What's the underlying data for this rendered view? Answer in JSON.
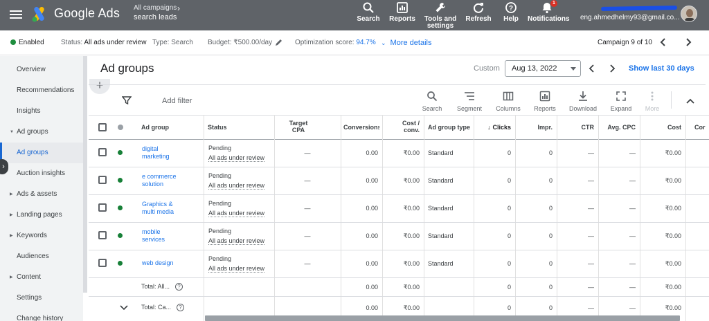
{
  "header": {
    "brand": "Google Ads",
    "campaign_selector": {
      "line1": "All campaigns",
      "line2": "search leads"
    },
    "tools": [
      {
        "label": "Search",
        "icon": "search-icon"
      },
      {
        "label": "Reports",
        "icon": "reports-icon"
      },
      {
        "label": "Tools and settings",
        "icon": "wrench-icon"
      },
      {
        "label": "Refresh",
        "icon": "refresh-icon"
      },
      {
        "label": "Help",
        "icon": "help-icon"
      },
      {
        "label": "Notifications",
        "icon": "bell-icon",
        "badge": "1"
      }
    ],
    "account_email": "eng.ahmedhelmy93@gmail.co..."
  },
  "status_bar": {
    "enabled": "Enabled",
    "status_label": "Status:",
    "status_value": "All ads under review",
    "type_label": "Type:",
    "type_value": "Search",
    "budget_label": "Budget:",
    "budget_value": "₹500.00/day",
    "opt_label": "Optimization score:",
    "opt_value": "94.7%",
    "more_details": "More details",
    "campaign_count": "Campaign 9 of 10"
  },
  "sidebar": {
    "items": [
      {
        "label": "Overview"
      },
      {
        "label": "Recommendations"
      },
      {
        "label": "Insights"
      },
      {
        "label": "Ad groups",
        "expandable": true,
        "expanded": true
      },
      {
        "label": "Ad groups",
        "active": true
      },
      {
        "label": "Auction insights"
      },
      {
        "label": "Ads & assets",
        "expandable": true
      },
      {
        "label": "Landing pages",
        "expandable": true
      },
      {
        "label": "Keywords",
        "expandable": true
      },
      {
        "label": "Audiences"
      },
      {
        "label": "Content",
        "expandable": true
      },
      {
        "label": "Settings"
      },
      {
        "label": "Change history"
      }
    ]
  },
  "main": {
    "title": "Ad groups",
    "date_mode": "Custom",
    "date_value": "Aug 13, 2022",
    "show_last": "Show last 30 days",
    "plus": "+",
    "add_filter": "Add filter",
    "toolbar": [
      {
        "label": "Search",
        "icon": "search-icon"
      },
      {
        "label": "Segment",
        "icon": "segment-icon"
      },
      {
        "label": "Columns",
        "icon": "columns-icon"
      },
      {
        "label": "Reports",
        "icon": "reports-icon"
      },
      {
        "label": "Download",
        "icon": "download-icon"
      },
      {
        "label": "Expand",
        "icon": "expand-icon"
      },
      {
        "label": "More",
        "icon": "more-vert-icon",
        "disabled": true
      }
    ]
  },
  "table": {
    "columns": {
      "ad_group": "Ad group",
      "status": "Status",
      "target_cpa_1": "Target",
      "target_cpa_2": "CPA",
      "conversions": "Conversions",
      "cost_conv_1": "Cost /",
      "cost_conv_2": "conv.",
      "ad_group_type": "Ad group type",
      "clicks": "Clicks",
      "impr": "Impr.",
      "ctr": "CTR",
      "avg_cpc": "Avg. CPC",
      "cost": "Cost",
      "cut": "Cor"
    },
    "rows": [
      {
        "name1": "digital",
        "name2": "marketing",
        "status1": "Pending",
        "status2": "All ads under review",
        "target_cpa": "—",
        "conversions": "0.00",
        "cost_conv": "₹0.00",
        "type": "Standard",
        "clicks": "0",
        "impr": "0",
        "ctr": "—",
        "avg_cpc": "—",
        "cost": "₹0.00"
      },
      {
        "name1": "e commerce",
        "name2": "solution",
        "status1": "Pending",
        "status2": "All ads under review",
        "target_cpa": "—",
        "conversions": "0.00",
        "cost_conv": "₹0.00",
        "type": "Standard",
        "clicks": "0",
        "impr": "0",
        "ctr": "—",
        "avg_cpc": "—",
        "cost": "₹0.00"
      },
      {
        "name1": "Graphics &",
        "name2": "multi media",
        "status1": "Pending",
        "status2": "All ads under review",
        "target_cpa": "—",
        "conversions": "0.00",
        "cost_conv": "₹0.00",
        "type": "Standard",
        "clicks": "0",
        "impr": "0",
        "ctr": "—",
        "avg_cpc": "—",
        "cost": "₹0.00"
      },
      {
        "name1": "mobile",
        "name2": "services",
        "status1": "Pending",
        "status2": "All ads under review",
        "target_cpa": "—",
        "conversions": "0.00",
        "cost_conv": "₹0.00",
        "type": "Standard",
        "clicks": "0",
        "impr": "0",
        "ctr": "—",
        "avg_cpc": "—",
        "cost": "₹0.00"
      },
      {
        "name1": "web design",
        "name2": "",
        "status1": "Pending",
        "status2": "All ads under review",
        "target_cpa": "—",
        "conversions": "0.00",
        "cost_conv": "₹0.00",
        "type": "Standard",
        "clicks": "0",
        "impr": "0",
        "ctr": "—",
        "avg_cpc": "—",
        "cost": "₹0.00"
      }
    ],
    "totals": [
      {
        "label": "Total: All...",
        "conversions": "0.00",
        "cost_conv": "₹0.00",
        "clicks": "0",
        "impr": "0",
        "ctr": "—",
        "avg_cpc": "—",
        "cost": "₹0.00"
      },
      {
        "label": "Total: Ca...",
        "conversions": "0.00",
        "cost_conv": "₹0.00",
        "clicks": "0",
        "impr": "0",
        "ctr": "—",
        "avg_cpc": "—",
        "cost": "₹0.00"
      }
    ],
    "help_glyph": "?"
  },
  "colors": {
    "header_bg": "#5f6368",
    "accent_blue": "#1a73e8",
    "enabled_green": "#1e8e3e"
  }
}
